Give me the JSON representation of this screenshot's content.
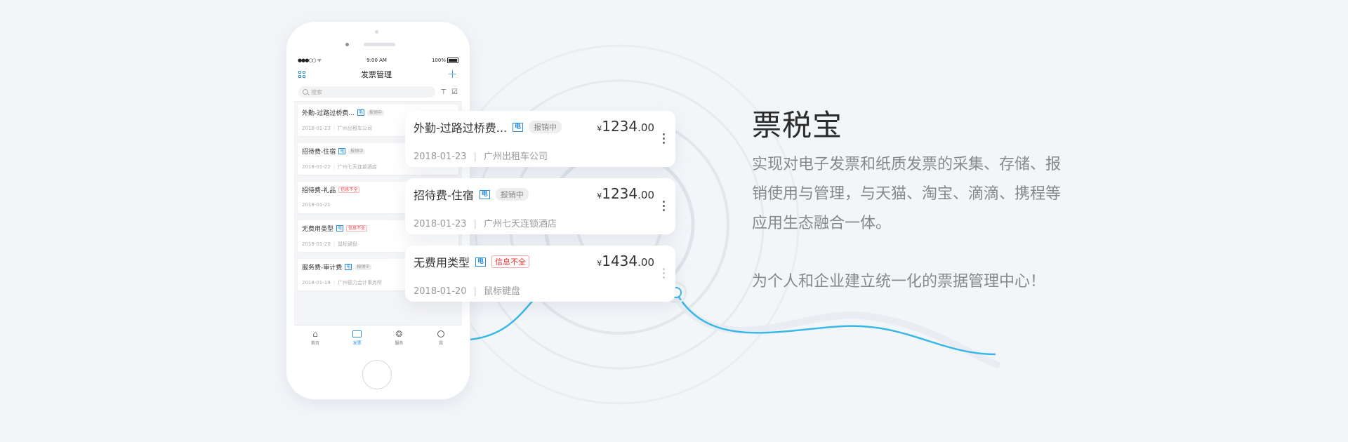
{
  "phone": {
    "status": {
      "signal": "●●●○○",
      "wifi": "ᯤ",
      "time": "9:00 AM",
      "battery": "100%"
    },
    "nav_title": "发票管理",
    "search_placeholder": "搜索",
    "items": [
      {
        "title": "外勤-过路过桥费...",
        "type_tag": "电",
        "status": "报销中",
        "status_kind": "gray",
        "date": "2018-01-23",
        "vendor": "广州出租车公司"
      },
      {
        "title": "招待费-住宿",
        "type_tag": "电",
        "status": "报销中",
        "status_kind": "gray",
        "date": "2018-01-22",
        "vendor": "广州七天连锁酒店"
      },
      {
        "title": "招待费-礼品",
        "type_tag": "",
        "status": "信息不全",
        "status_kind": "red",
        "date": "2018-01-21",
        "vendor": ""
      },
      {
        "title": "无费用类型",
        "type_tag": "电",
        "status": "信息不全",
        "status_kind": "red",
        "date": "2018-01-20",
        "vendor": "鼠标键盘"
      },
      {
        "title": "服务费-审计费",
        "type_tag": "电",
        "status": "报销中",
        "status_kind": "gray",
        "date": "2018-01-19",
        "vendor": "广州德力会计事务所"
      }
    ],
    "tabs": [
      {
        "label": "首页",
        "icon": "home-icon"
      },
      {
        "label": "发票",
        "icon": "invoice-icon",
        "active": true
      },
      {
        "label": "服务",
        "icon": "service-icon"
      },
      {
        "label": "我",
        "icon": "user-icon"
      }
    ]
  },
  "cards": [
    {
      "title": "外勤-过路过桥费...",
      "type_tag": "电",
      "status": "报销中",
      "status_kind": "gray",
      "currency": "¥",
      "amount_int": "1234",
      "amount_dec": ".00",
      "date": "2018-01-23",
      "vendor": "广州出租车公司"
    },
    {
      "title": "招待费-住宿",
      "type_tag": "电",
      "status": "报销中",
      "status_kind": "gray",
      "currency": "¥",
      "amount_int": "1234",
      "amount_dec": ".00",
      "date": "2018-01-23",
      "vendor": "广州七天连锁酒店"
    },
    {
      "title": "无费用类型",
      "type_tag": "电",
      "status": "信息不全",
      "status_kind": "red",
      "currency": "¥",
      "amount_int": "1434",
      "amount_dec": ".00",
      "date": "2018-01-20",
      "vendor": "鼠标键盘"
    }
  ],
  "headline": "票税宝",
  "description": "实现对电子发票和纸质发票的采集、存储、报销使用与管理，与天猫、淘宝、滴滴、携程等应用生态融合一体。",
  "slogan": "为个人和企业建立统一化的票据管理中心！",
  "colors": {
    "accent": "#2b8fe0",
    "wave": "#38b8e6",
    "background": "#f3f6f9"
  }
}
